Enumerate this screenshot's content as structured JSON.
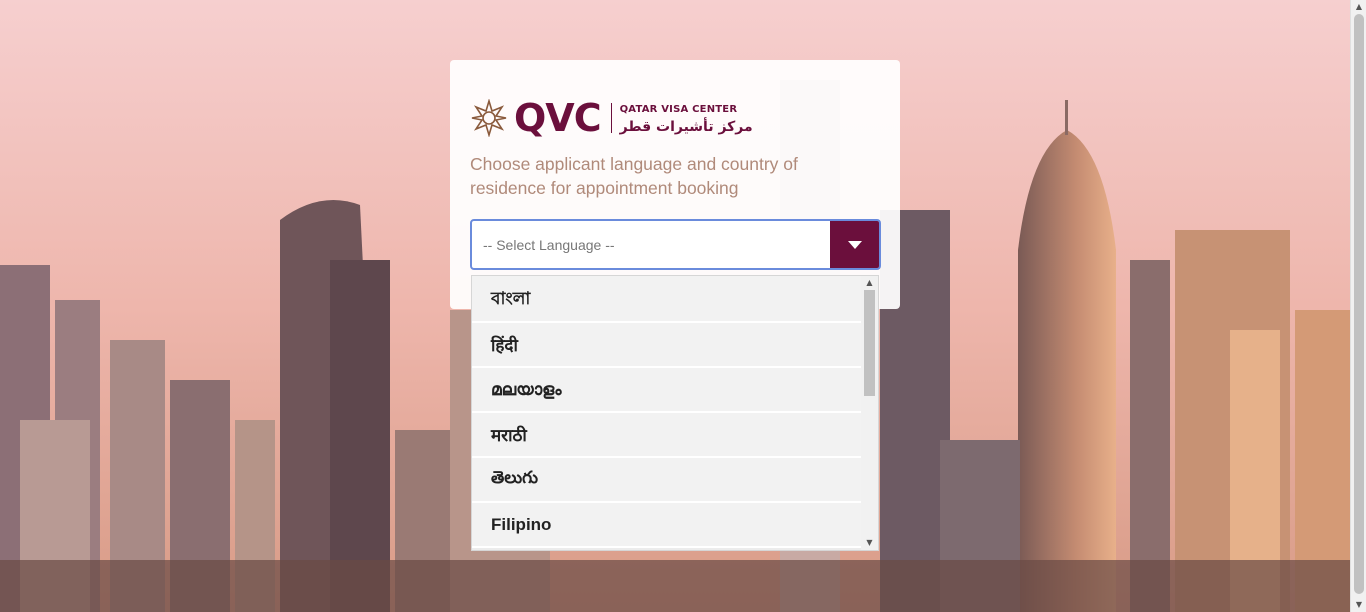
{
  "logo": {
    "wordmark": "QVC",
    "english_name": "QATAR VISA CENTER",
    "arabic_name": "مركز تأشيرات قطر"
  },
  "heading": "Choose applicant language and country of residence for appointment booking",
  "language_select": {
    "placeholder": "-- Select Language --",
    "options": [
      "বাংলা",
      "हिंदी",
      "മലയാളം",
      "मराठी",
      "తెలుగు",
      "Filipino"
    ]
  },
  "colors": {
    "brand": "#6b0f3c",
    "focus_border": "#6a8bdc",
    "heading_text": "#b08a7a"
  },
  "icons": {
    "logo_mark": "star-ornament-icon",
    "select_toggle": "caret-down-icon"
  }
}
